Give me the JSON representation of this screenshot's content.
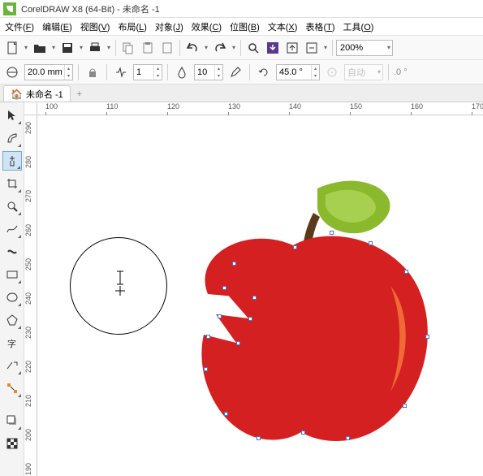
{
  "window": {
    "title": "CorelDRAW X8 (64-Bit) - 未命名 -1"
  },
  "menu": {
    "file": {
      "label": "文件",
      "accel": "F"
    },
    "edit": {
      "label": "编辑",
      "accel": "E"
    },
    "view": {
      "label": "视图",
      "accel": "V"
    },
    "layout": {
      "label": "布局",
      "accel": "L"
    },
    "object": {
      "label": "对象",
      "accel": "J"
    },
    "effect": {
      "label": "效果",
      "accel": "C"
    },
    "bitmap": {
      "label": "位图",
      "accel": "B"
    },
    "text": {
      "label": "文本",
      "accel": "X"
    },
    "table": {
      "label": "表格",
      "accel": "T"
    },
    "tools": {
      "label": "工具",
      "accel": "O"
    }
  },
  "toolbar": {
    "zoom": "200%"
  },
  "propbar": {
    "eraser_size": "20.0 mm",
    "freq": "1",
    "smoothing": "10",
    "angle": "45.0 °",
    "auto_label": "自动",
    "zero": ".0 °"
  },
  "tabs": {
    "doc1": "未命名 -1"
  },
  "ruler_h": [
    "100",
    "110",
    "120",
    "130",
    "140",
    "150",
    "160",
    "170"
  ],
  "ruler_v": [
    "290",
    "280",
    "270",
    "260",
    "250",
    "240",
    "230",
    "220",
    "210",
    "200",
    "190"
  ]
}
